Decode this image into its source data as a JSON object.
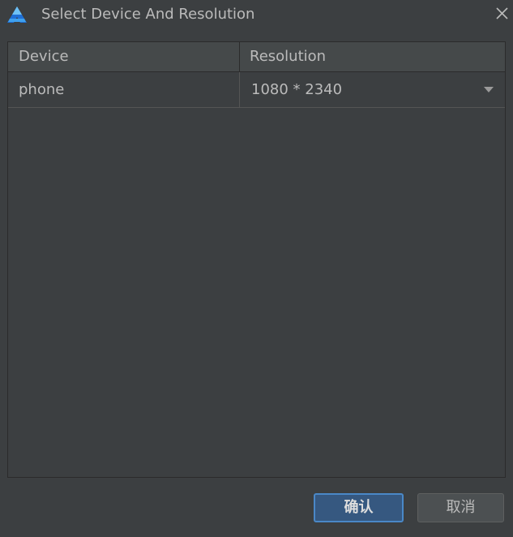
{
  "window": {
    "title": "Select Device And Resolution"
  },
  "table": {
    "columns": [
      "Device",
      "Resolution"
    ],
    "rows": [
      {
        "device": "phone",
        "resolution": "1080 * 2340"
      }
    ]
  },
  "buttons": {
    "ok_label": "确认",
    "cancel_label": "取消"
  },
  "colors": {
    "background": "#3c3f41",
    "primary_button": "#365880",
    "primary_button_border": "#4a88c7",
    "icon_light_blue": "#6ec1f5",
    "icon_dark_blue": "#1f6fd6"
  }
}
